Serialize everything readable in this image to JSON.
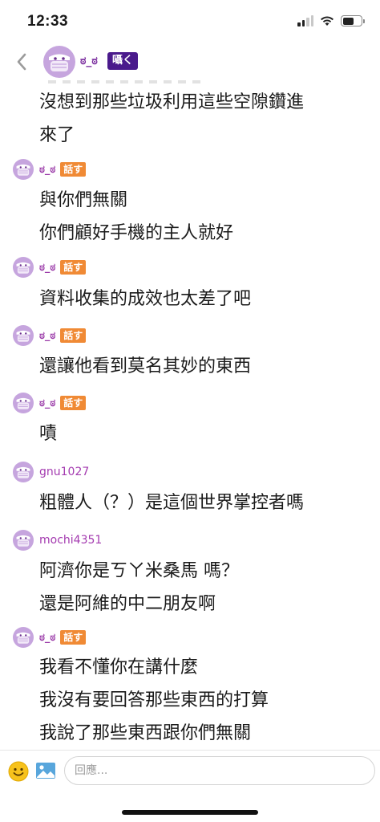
{
  "status_bar": {
    "time": "12:33"
  },
  "header": {
    "name": "ಠ_ಠ",
    "badge": "囁く"
  },
  "messages": [
    {
      "lines": "沒想到那些垃圾利用這些空隙鑽進\n來了"
    },
    {
      "author": "ಠ_ಠ",
      "badge": "話す",
      "lines": "與你們無關\n你們顧好手機的主人就好"
    },
    {
      "author": "ಠ_ಠ",
      "badge": "話す",
      "lines": "資料收集的成效也太差了吧"
    },
    {
      "author": "ಠ_ಠ",
      "badge": "話す",
      "lines": "還讓他看到莫名其妙的東西"
    },
    {
      "author": "ಠ_ಠ",
      "badge": "話す",
      "lines": "嘖"
    },
    {
      "author": "gnu1027",
      "lines": "粗體人（？）是這個世界掌控者嗎"
    },
    {
      "author": "mochi4351",
      "lines": "阿濟你是ㄎㄚ米桑馬 嗎？\n還是阿維的中二朋友啊"
    },
    {
      "author": "ಠ_ಠ",
      "badge": "話す",
      "lines": "我看不懂你在講什麼\n我沒有要回答那些東西的打算\n我說了那些東西跟你們無關"
    }
  ],
  "input": {
    "placeholder": "回應..."
  },
  "icons": {
    "back": "chevron-left-icon",
    "emoji": "smiley-icon",
    "image": "image-icon",
    "avatar": "masked-face-icon"
  },
  "colors": {
    "name_purple": "#9a3aa8",
    "badge_orange": "#f08a35",
    "badge_dark_purple": "#4a1a8c",
    "avatar_lavender": "#b88fd4"
  }
}
